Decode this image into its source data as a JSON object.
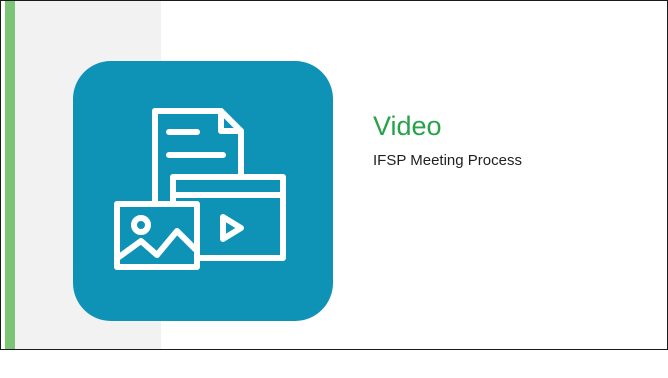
{
  "slide": {
    "title": "Video",
    "subtitle": "IFSP Meeting Process",
    "icon": "media-files-icon"
  },
  "colors": {
    "accent_bar": "#7cc576",
    "left_panel": "#f2f2f2",
    "icon_tile": "#0e93b6",
    "title_text": "#27a24a",
    "subtitle_text": "#1f1f1f"
  }
}
